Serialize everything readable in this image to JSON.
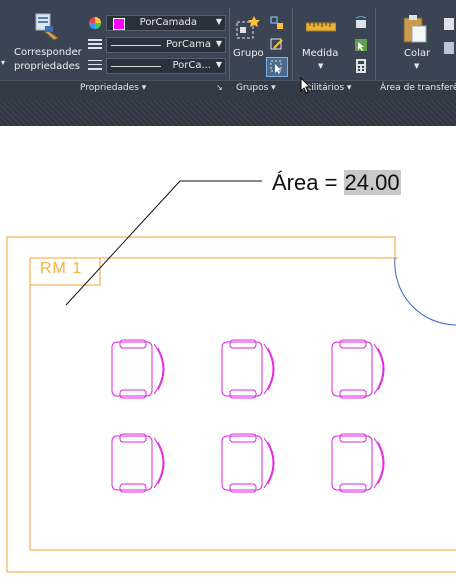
{
  "ribbon": {
    "match_properties": {
      "line1": "Corresponder",
      "line2": "propriedades"
    },
    "color_dropdown": {
      "value": "PorCamada",
      "swatch": "#ff00ff"
    },
    "linetype_dropdown": {
      "value": "PorCama"
    },
    "lineweight_dropdown": {
      "value": "PorCa..."
    },
    "group_button": "Grupo",
    "measure_button": "Medida",
    "paste_button": "Colar",
    "panels": {
      "properties": "Propriedades ▾",
      "groups": "Grupos ▾",
      "utilities": "Utilitários ▾",
      "clipboard": "Área de transferê"
    }
  },
  "drawing": {
    "area_label": "Área = ",
    "area_value": "24.00",
    "room_tag": "RM 1",
    "colors": {
      "room": "#f0a030",
      "chairs": "#e020e0",
      "door": "#3a5fcd",
      "leader": "#111111"
    }
  }
}
